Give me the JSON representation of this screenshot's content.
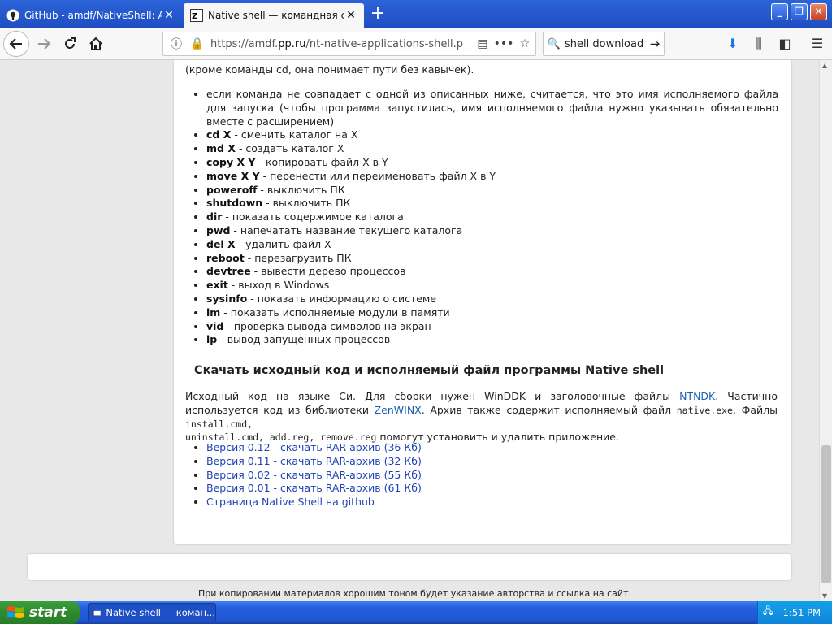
{
  "tabs": [
    {
      "title": "GitHub - amdf/NativeShell: A shell",
      "active": false
    },
    {
      "title": "Native shell — командная строка",
      "active": true
    }
  ],
  "nav": {
    "url_prefix": "https://amdf.",
    "url_domain": "pp.ru",
    "url_path": "/nt-native-applications-shell.p",
    "search_text": "shell download",
    "more_label": "•••"
  },
  "content": {
    "intro": "(кроме команды cd, она понимает пути без кавычек).",
    "first_item": "если команда не совпадает с одной из описанных ниже, считается, что это имя исполняемого файла для запуска (чтобы программа запустилась, имя исполняемого файла нужно указывать обязательно вместе с расширением)",
    "commands": [
      {
        "cmd": "cd X",
        "desc": " - сменить каталог на X"
      },
      {
        "cmd": "md X",
        "desc": " - создать каталог X"
      },
      {
        "cmd": "copy X Y",
        "desc": " - копировать файл X в Y"
      },
      {
        "cmd": "move X Y",
        "desc": " - перенести или переименовать файл X в Y"
      },
      {
        "cmd": "poweroff",
        "desc": " - выключить ПК"
      },
      {
        "cmd": "shutdown",
        "desc": " - выключить ПК"
      },
      {
        "cmd": "dir",
        "desc": " - показать содержимое каталога"
      },
      {
        "cmd": "pwd",
        "desc": " - напечатать название текущего каталога"
      },
      {
        "cmd": "del X",
        "desc": " - удалить файл X"
      },
      {
        "cmd": "reboot",
        "desc": " - перезагрузить ПК"
      },
      {
        "cmd": "devtree",
        "desc": " - вывести дерево процессов"
      },
      {
        "cmd": "exit",
        "desc": " - выход в Windows"
      },
      {
        "cmd": "sysinfo",
        "desc": " - показать информацию о системе"
      },
      {
        "cmd": "lm",
        "desc": " - показать исполняемые модули в памяти"
      },
      {
        "cmd": "vid",
        "desc": " - проверка вывода символов на экран"
      },
      {
        "cmd": "lp",
        "desc": " - вывод запущенных процессов"
      }
    ],
    "download_heading": "Скачать исходный код и исполняемый файл программы Native shell",
    "para": {
      "t1": "Исходный код на языке Си. Для сборки нужен WinDDK и заголовочные файлы ",
      "link1": "NTNDK",
      "t2": ". Частично используется код из библиотеки ",
      "link2": "ZenWINX",
      "t3": ". Архив также содержит исполняемый файл ",
      "m1": "native.exe",
      "t4": ". Файлы ",
      "m2": "install.cmd,",
      "m3": "uninstall.cmd, add.reg, remove.reg",
      "t5": " помогут установить и удалить приложение."
    },
    "downloads": [
      "Версия 0.12 - скачать RAR-архив (36 Кб)",
      "Версия 0.11 - скачать RAR-архив (32 Кб)",
      "Версия 0.02 - скачать RAR-архив (55 Кб)",
      "Версия 0.01 - скачать RAR-архив (61 Кб)",
      "Страница Native Shell на github"
    ],
    "footer": "При копировании материалов хорошим тоном будет указание авторства и ссылка на сайт."
  },
  "taskbar": {
    "start_label": "start",
    "task_label": "Native shell — коман...",
    "clock": "1:51 PM"
  },
  "colors": {
    "link": "#1f43b5",
    "taskbar": "#245edb",
    "start": "#2f8a2f"
  }
}
